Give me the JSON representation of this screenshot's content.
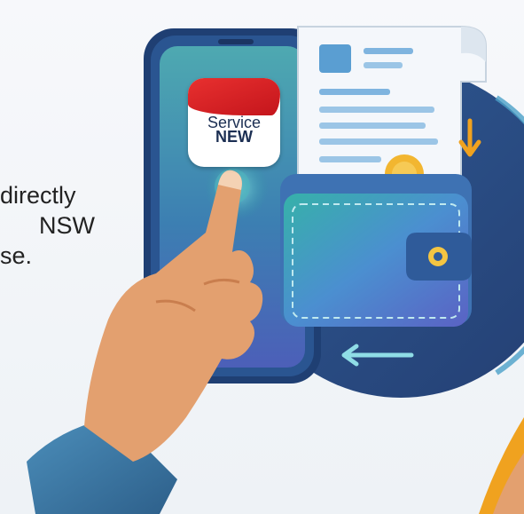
{
  "caption": {
    "line1": "directly",
    "line2": "NSW",
    "line3": "se."
  },
  "app_badge": {
    "line1": "Service",
    "line2": "NEW"
  },
  "colors": {
    "circle": "#2e4f86",
    "phone_frame": "#2a4f8a",
    "phone_screen": "#2f9aa4",
    "wallet": "#4a8ec9",
    "receipt": "#eef3f8",
    "skin": "#e3a06f",
    "sleeve": "#3b7ba6",
    "accent_red": "#d9222a",
    "arrow_orange": "#f0a21f"
  }
}
